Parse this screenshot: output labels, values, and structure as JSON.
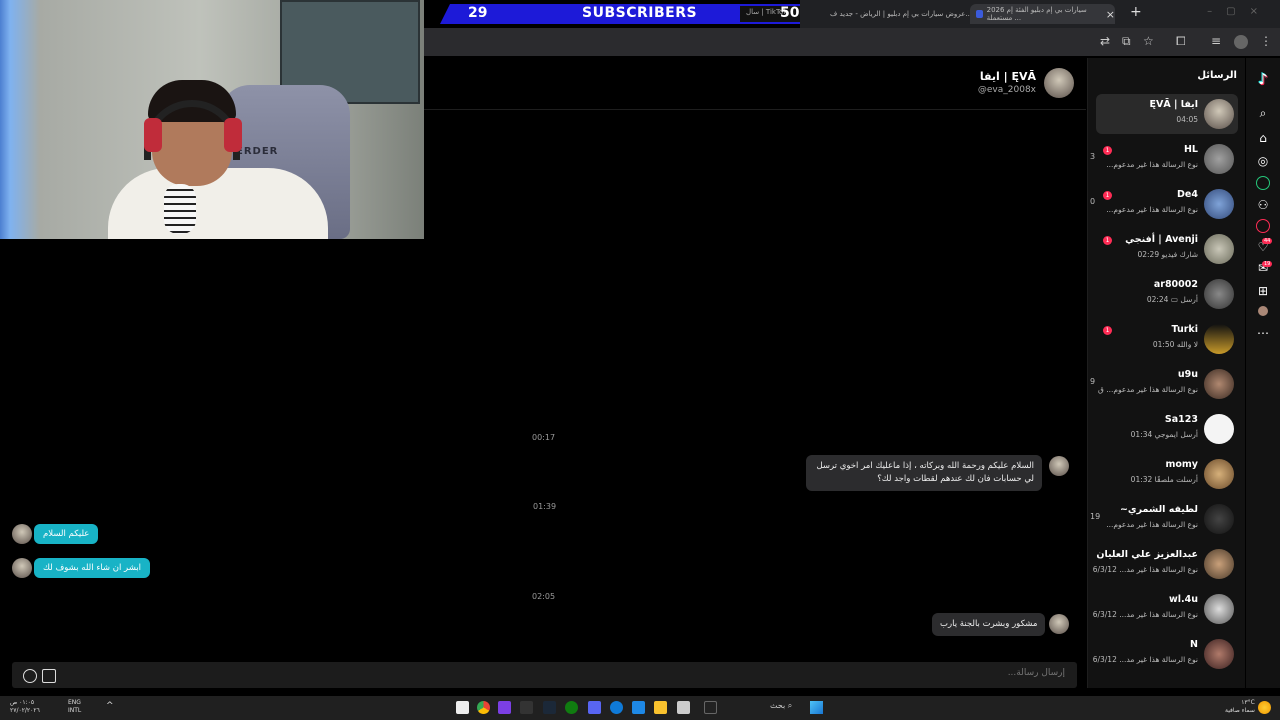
{
  "overlay": {
    "subscribers_count": "29",
    "subscribers_label": "SUBSCRIBERS",
    "subscribers_goal": "50",
    "goal_caption": "سال | TikTok"
  },
  "browser": {
    "tabs": [
      {
        "title": "عروض سيارات بي إم دبليو | الرياض - جديد ف..."
      },
      {
        "title": "سيارات بي إم دبليو الفئة إم 2026 مستعملة ..."
      }
    ]
  },
  "chat": {
    "contact_name": "ايفا | ĘVĀ",
    "contact_handle": "@eva_2008x",
    "messages": [
      {
        "time": "00:17"
      },
      {
        "text_line1": "السلام عليكم ورحمة الله وبركاته ، إذا ماعليك امر اخوي ترسل",
        "text_line2": "لي حسابات فان لك عندهم لقطات واجد لك؟"
      },
      {
        "time": "01:39"
      },
      {
        "text": "عليكم السلام"
      },
      {
        "text": "ابشر ان شاء الله بشوف لك"
      },
      {
        "time": "02:05"
      },
      {
        "text": "مشكور وبشرت بالجنة يارب"
      }
    ],
    "composer_placeholder": "إرسال رسالة..."
  },
  "sidebar": {
    "title": "الرسائل",
    "conversations": [
      {
        "name": "ايفا | ĘVĀ",
        "preview": "04:05",
        "badge": "",
        "cut": ""
      },
      {
        "name": "HL",
        "preview": "نوع الرسالة هذا غير مدعوم...",
        "badge": "1",
        "cut": "3"
      },
      {
        "name": "De4",
        "preview": "نوع الرسالة هذا غير مدعوم...",
        "badge": "1",
        "cut": "0"
      },
      {
        "name": "Avenji | أفنجي",
        "preview": "شارك فيديو 02:29",
        "badge": "1",
        "cut": ""
      },
      {
        "name": "ar80002",
        "preview": "أرسل ▭ 02:24",
        "badge": "",
        "cut": ""
      },
      {
        "name": "Turki",
        "preview": "لا والله 01:50",
        "badge": "1",
        "cut": ""
      },
      {
        "name": "u9u",
        "preview": "نوع الرسالة هذا غير مدعوم... ق",
        "badge": "",
        "cut": "9"
      },
      {
        "name": "Sa123",
        "preview": "أرسل ايموجي 01:34",
        "badge": "",
        "cut": ""
      },
      {
        "name": "momy",
        "preview": "أرسلت ملصقًا 01:32",
        "badge": "",
        "cut": ""
      },
      {
        "name": "لطيفه الشمري~",
        "preview": "نوع الرسالة هذا غير مدعوم...",
        "badge": "",
        "cut": "19"
      },
      {
        "name": "عبدالعزيز علي العليان",
        "preview": "نوع الرسالة هذا غير مد... 6/3/12",
        "badge": "",
        "cut": ""
      },
      {
        "name": "wl.4u",
        "preview": "نوع الرسالة هذا غير مد... 6/3/12",
        "badge": "",
        "cut": ""
      },
      {
        "name": "N",
        "preview": "نوع الرسالة هذا غير مد... 6/3/12",
        "badge": "",
        "cut": ""
      }
    ]
  },
  "nav_badges": {
    "msgs": "44",
    "inbox": "19"
  },
  "taskbar": {
    "clock": "٠١:٠٥ ص",
    "date": "٢٧/٠٢/٢٠٢٦",
    "lang": "ENG",
    "lang_sub": "INTL",
    "search_label": "بحث",
    "weather_temp": "١٣°C",
    "weather_desc": "سماء صافية"
  }
}
